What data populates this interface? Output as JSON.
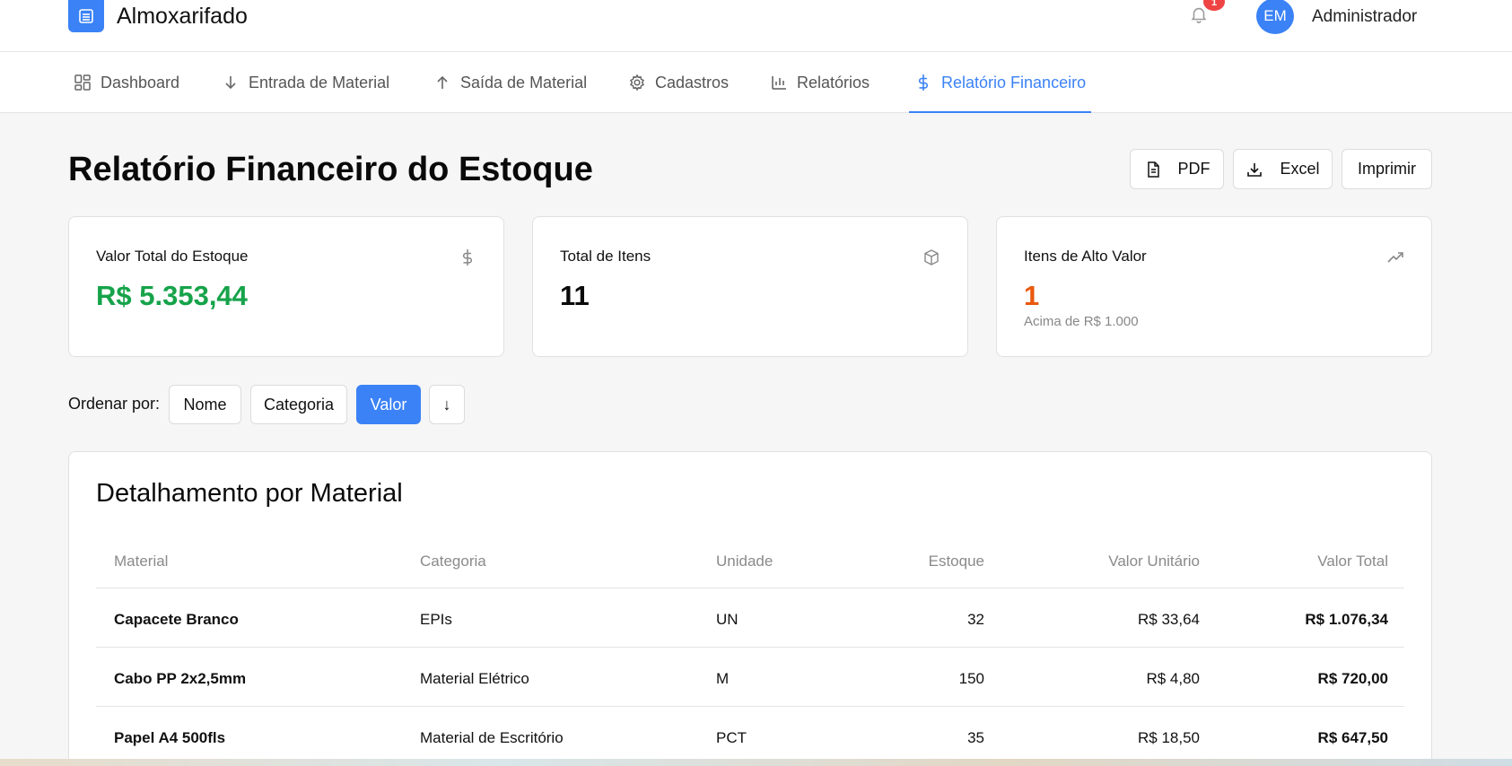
{
  "app": {
    "title": "Almoxarifado",
    "notification_count": "1",
    "user_initials": "EM",
    "user_name": "Administrador"
  },
  "nav": {
    "items": [
      {
        "label": "Dashboard",
        "icon": "grid-icon"
      },
      {
        "label": "Entrada de Material",
        "icon": "arrow-down-icon"
      },
      {
        "label": "Saída de Material",
        "icon": "arrow-up-icon"
      },
      {
        "label": "Cadastros",
        "icon": "gear-icon"
      },
      {
        "label": "Relatórios",
        "icon": "bar-chart-icon"
      },
      {
        "label": "Relatório Financeiro",
        "icon": "dollar-icon",
        "active": true
      }
    ]
  },
  "page": {
    "title": "Relatório Financeiro do Estoque",
    "actions": {
      "pdf": "PDF",
      "excel": "Excel",
      "print": "Imprimir"
    }
  },
  "cards": [
    {
      "label": "Valor Total do Estoque",
      "value": "R$ 5.353,44",
      "icon": "dollar-icon",
      "color": "#16a34a"
    },
    {
      "label": "Total de Itens",
      "value": "11",
      "icon": "box-icon",
      "color": "#0a0a0a"
    },
    {
      "label": "Itens de Alto Valor",
      "value": "1",
      "sub": "Acima de R$ 1.000",
      "icon": "trending-up-icon",
      "color": "#ea580c"
    }
  ],
  "sort": {
    "label": "Ordenar por:",
    "options": [
      "Nome",
      "Categoria",
      "Valor"
    ],
    "selected": "Valor",
    "direction": "↓"
  },
  "table": {
    "title": "Detalhamento por Material",
    "headers": [
      "Material",
      "Categoria",
      "Unidade",
      "Estoque",
      "Valor Unitário",
      "Valor Total"
    ],
    "rows": [
      {
        "material": "Capacete Branco",
        "categoria": "EPIs",
        "unidade": "UN",
        "estoque": "32",
        "unitario": "R$ 33,64",
        "total": "R$ 1.076,34"
      },
      {
        "material": "Cabo PP 2x2,5mm",
        "categoria": "Material Elétrico",
        "unidade": "M",
        "estoque": "150",
        "unitario": "R$ 4,80",
        "total": "R$ 720,00"
      },
      {
        "material": "Papel A4 500fls",
        "categoria": "Material de Escritório",
        "unidade": "PCT",
        "estoque": "35",
        "unitario": "R$ 18,50",
        "total": "R$ 647,50"
      }
    ]
  }
}
